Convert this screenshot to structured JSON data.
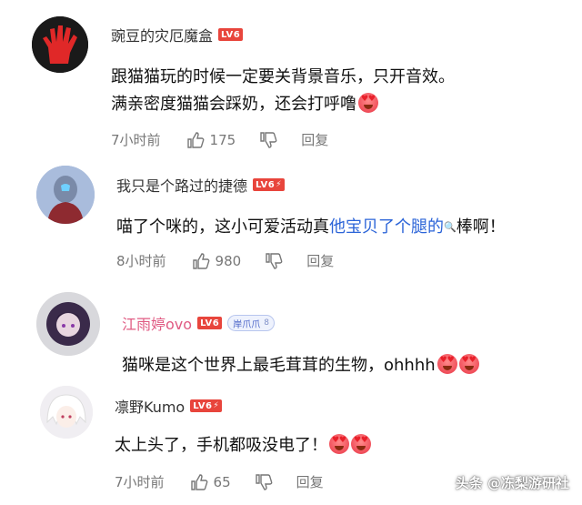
{
  "comments": [
    {
      "username": "豌豆的灾厄魔盒",
      "level": "LV6",
      "lines": [
        "跟猫猫玩的时候一定要关背景音乐，只开音效。",
        "满亲密度猫猫会踩奶，还会打呼噜"
      ],
      "emoji": "heart-eyes-emoji",
      "time": "7小时前",
      "likes": "175",
      "reply": "回复"
    },
    {
      "username": "我只是个路过的捷德",
      "level": "LV6",
      "text_before": "喵了个咪的，这小可爱活动真",
      "link": "他宝贝了个腿的",
      "text_after": "棒啊！",
      "time": "8小时前",
      "likes": "980",
      "reply": "回复"
    },
    {
      "username": "江雨婷ovo",
      "level": "LV6",
      "fan_badge": "岸爪爪",
      "fan_level": "8",
      "text": "猫咪是这个世界上最毛茸茸的生物，ohhhh",
      "emoji": "heart-eyes-emoji"
    },
    {
      "username": "凛野Kumo",
      "level": "LV6",
      "text": "太上头了，手机都吸没电了！",
      "emoji": "heart-eyes-emoji",
      "time": "7小时前",
      "likes": "65",
      "reply": "回复"
    }
  ],
  "watermark": "头条 @冻梨游研社",
  "colors": {
    "username_pink": "#e05a82",
    "link_blue": "#2b64d8",
    "level_badge": "#e8453c"
  }
}
